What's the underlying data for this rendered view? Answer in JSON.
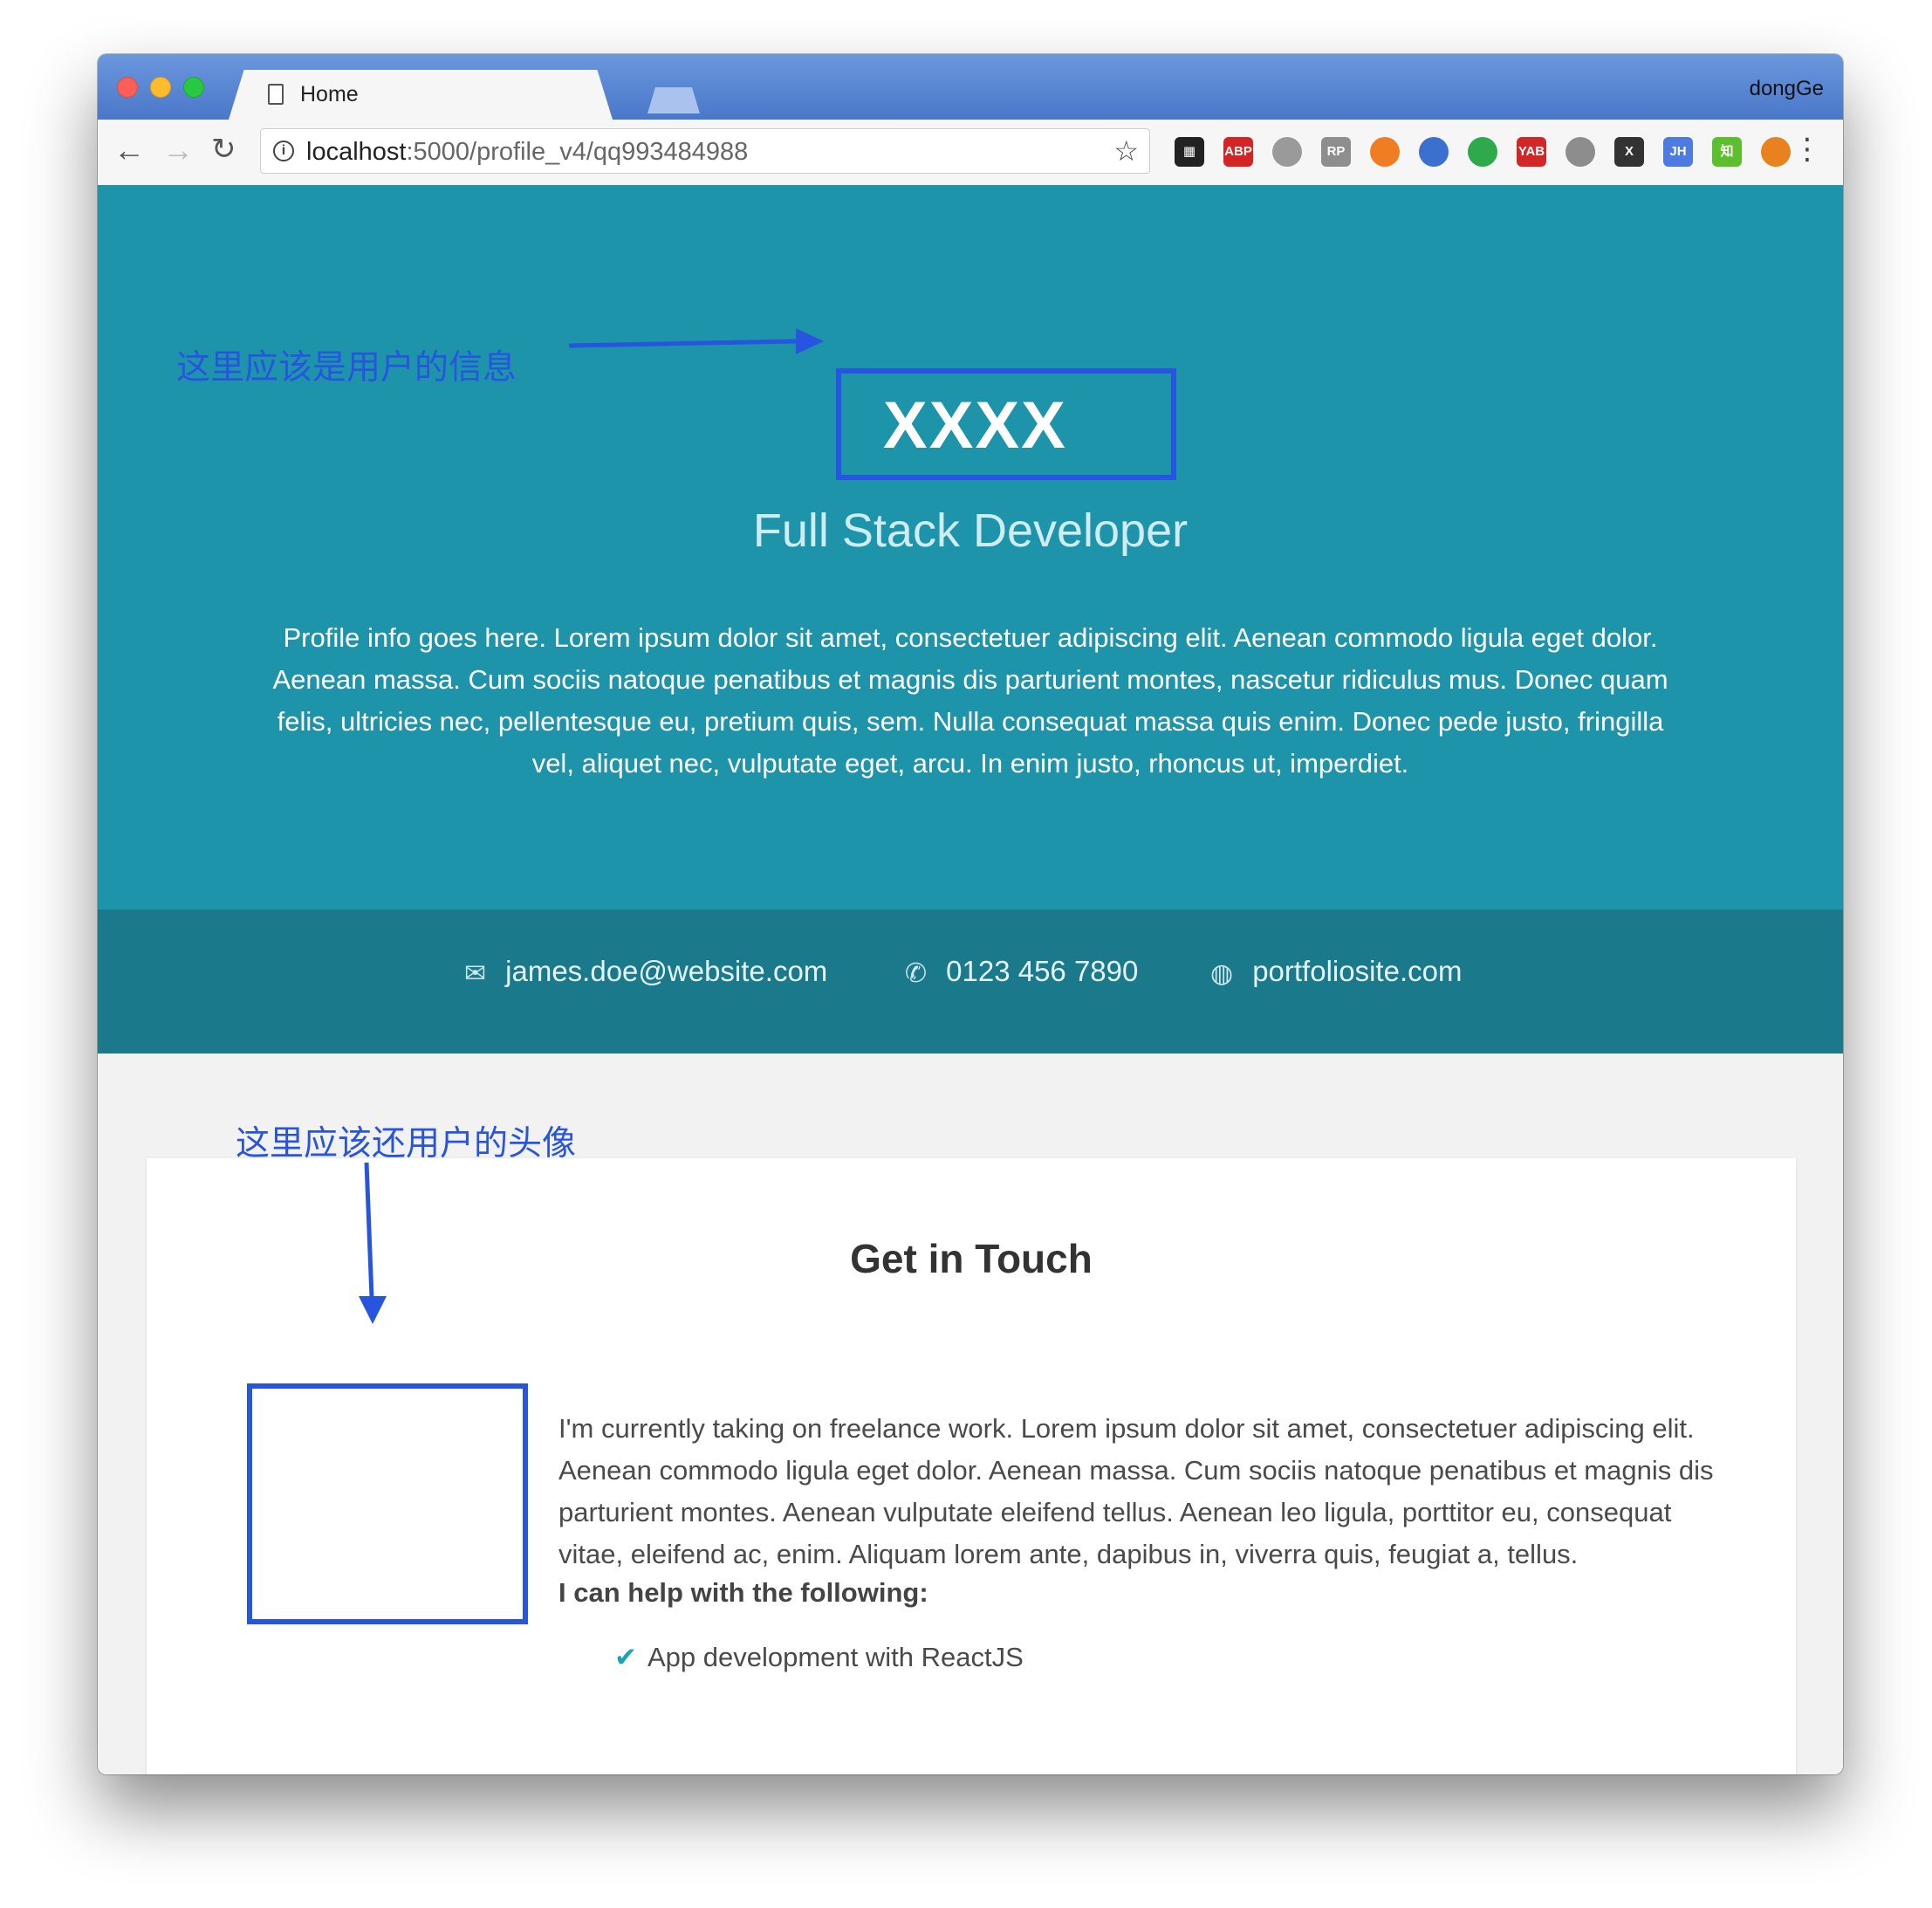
{
  "browser": {
    "tab_title": "Home",
    "tab_close": "×",
    "profile_name": "dongGe",
    "url_host": "localhost",
    "url_rest": ":5000/profile_v4/qq993484988",
    "extensions": [
      {
        "name": "qr-code-extension-icon",
        "label": "▦",
        "color": "#222222"
      },
      {
        "name": "adblock-plus-icon",
        "label": "ABP",
        "color": "#d42424"
      },
      {
        "name": "globe-extension-icon",
        "label": "",
        "color": "#9a9a9a"
      },
      {
        "name": "rp-extension-icon",
        "label": "RP",
        "color": "#8e8e8e"
      },
      {
        "name": "lifebuoy-extension-icon",
        "label": "",
        "color": "#f07d22"
      },
      {
        "name": "fiddler-extension-icon",
        "label": "",
        "color": "#3b6fd0"
      },
      {
        "name": "shield-extension-icon",
        "label": "",
        "color": "#2eaa4a"
      },
      {
        "name": "yab-extension-icon",
        "label": "YAB",
        "color": "#d32727"
      },
      {
        "name": "ball-extension-icon",
        "label": "",
        "color": "#8d8d8d"
      },
      {
        "name": "x-extension-icon",
        "label": "X",
        "color": "#333333"
      },
      {
        "name": "jh-extension-icon",
        "label": "JH",
        "color": "#4d7be0"
      },
      {
        "name": "zhihu-extension-icon",
        "label": "知",
        "color": "#5cc02e"
      },
      {
        "name": "metamask-extension-icon",
        "label": "",
        "color": "#e8821e"
      }
    ]
  },
  "hero": {
    "annotation_user_info": "这里应该是用户的信息",
    "name": "XXXX",
    "tagline": "Full Stack Developer",
    "bio": "Profile info goes here. Lorem ipsum dolor sit amet, consectetuer adipiscing elit. Aenean commodo ligula eget dolor. Aenean massa. Cum sociis natoque penatibus et magnis dis parturient montes, nascetur ridiculus mus. Donec quam felis, ultricies nec, pellentesque eu, pretium quis, sem. Nulla consequat massa quis enim. Donec pede justo, fringilla vel, aliquet nec, vulputate eget, arcu. In enim justo, rhoncus ut, imperdiet."
  },
  "contact": {
    "email": "james.doe@website.com",
    "phone": "0123 456 7890",
    "website": "portfoliosite.com"
  },
  "main": {
    "annotation_avatar": "这里应该还用户的头像",
    "card_title": "Get in Touch",
    "card_text": "I'm currently taking on freelance work. Lorem ipsum dolor sit amet, consectetuer adipiscing elit. Aenean commodo ligula eget dolor. Aenean massa. Cum sociis natoque penatibus et magnis dis parturient montes. Aenean vulputate eleifend tellus. Aenean leo ligula, porttitor eu, consequat vitae, eleifend ac, enim. Aliquam lorem ante, dapibus in, viverra quis, feugiat a, tellus.",
    "help_title": "I can help with the following:",
    "help_items": [
      "App development with ReactJS"
    ]
  },
  "colors": {
    "hero_bg": "#1e94ab",
    "contact_bg": "#1a7a8c",
    "annotation": "#2855e0",
    "check": "#1ba3b8"
  }
}
